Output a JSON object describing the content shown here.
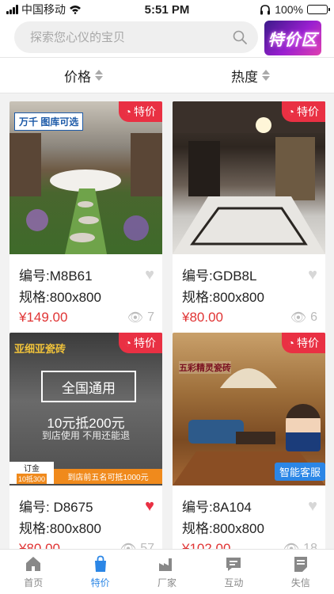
{
  "status_bar": {
    "carrier": "中国移动",
    "time": "5:51 PM",
    "battery": "100%",
    "battery_level": 1.0
  },
  "search": {
    "placeholder": "探索您心仪的宝贝",
    "zone_logo_text": "特价区"
  },
  "sort": [
    {
      "label": "价格"
    },
    {
      "label": "热度"
    }
  ],
  "products": [
    {
      "image_caption": "万千 图库可选",
      "tag": "特价",
      "code": "编号:M8B61",
      "spec": "规格:800x800",
      "price": "¥149.00",
      "views": "7",
      "liked": false
    },
    {
      "image_caption": "",
      "tag": "特价",
      "code": "编号:GDB8L",
      "spec": "规格:800x800",
      "price": "¥80.00",
      "views": "6",
      "liked": false
    },
    {
      "image_brand": "亚细亚瓷砖",
      "image_banner": "全国通用",
      "image_offer": "10元抵200元",
      "image_offer_sub": "到店使用 不用还能退",
      "image_deposit": "订金",
      "image_deposit_sub": "10抵300",
      "image_strip": "到店前五名可抵1000元",
      "tag": "特价",
      "code": "编号: D8675",
      "spec": "规格:800x800",
      "price": "¥80.00",
      "views": "57",
      "liked": true
    },
    {
      "image_brand": "五彩精灵瓷砖",
      "image_service": "智能客服",
      "tag": "特价",
      "code": "编号:8A104",
      "spec": "规格:800x800",
      "price": "¥102.00",
      "views": "18",
      "liked": false
    }
  ],
  "tabs": [
    {
      "label": "首页",
      "icon": "home-icon",
      "active": false
    },
    {
      "label": "特价",
      "icon": "shopping-bag-icon",
      "active": true
    },
    {
      "label": "厂家",
      "icon": "factory-icon",
      "active": false
    },
    {
      "label": "互动",
      "icon": "chat-icon",
      "active": false
    },
    {
      "label": "失信",
      "icon": "document-icon",
      "active": false
    }
  ],
  "colors": {
    "accent": "#2b86e6",
    "price": "#e03434",
    "tag": "#e93043"
  }
}
